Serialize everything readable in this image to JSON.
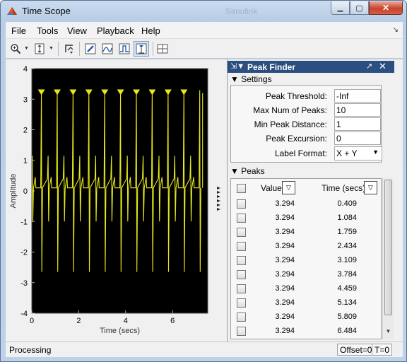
{
  "window": {
    "title": "Time Scope",
    "ghost_title": "Simulink",
    "minimize_glyph": "▁",
    "maximize_glyph": "▢",
    "close_glyph": "✕"
  },
  "menu": {
    "items": [
      "File",
      "Tools",
      "View",
      "Playback",
      "Help"
    ],
    "dock_arrow": "↘"
  },
  "toolbar": {
    "icons": [
      "zoom-in-icon",
      "zoom-y-icon",
      "autoscale-icon",
      "edit-style-icon",
      "bilevel-icon",
      "trigger-icon",
      "peak-finder-icon",
      "layout-icon"
    ],
    "dropdown_glyph": "▼"
  },
  "panel": {
    "title": "Peak Finder",
    "pin_glyph": "⇲▼",
    "undock_glyph": "↗",
    "close_glyph": "✕",
    "settings_heading": "▼ Settings",
    "settings": {
      "peak_threshold_label": "Peak Threshold:",
      "peak_threshold_value": "-Inf",
      "max_peaks_label": "Max Num of Peaks:",
      "max_peaks_value": "10",
      "min_distance_label": "Min Peak Distance:",
      "min_distance_value": "1",
      "peak_excursion_label": "Peak Excursion:",
      "peak_excursion_value": "0",
      "label_format_label": "Label Format:",
      "label_format_value": "X + Y",
      "select_arrow": "▼"
    },
    "peaks_heading": "▼ Peaks",
    "columns": {
      "value": "Value",
      "time": "Time (secs)",
      "sort_glyph": "▽"
    },
    "rows": [
      {
        "value": "3.294",
        "time": "0.409"
      },
      {
        "value": "3.294",
        "time": "1.084"
      },
      {
        "value": "3.294",
        "time": "1.759"
      },
      {
        "value": "3.294",
        "time": "2.434"
      },
      {
        "value": "3.294",
        "time": "3.109"
      },
      {
        "value": "3.294",
        "time": "3.784"
      },
      {
        "value": "3.294",
        "time": "4.459"
      },
      {
        "value": "3.294",
        "time": "5.134"
      },
      {
        "value": "3.294",
        "time": "5.809"
      },
      {
        "value": "3.294",
        "time": "6.484"
      }
    ],
    "scroll_down_glyph": "▼"
  },
  "status": {
    "text": "Processing",
    "offset": "Offset=0",
    "time": "T=0"
  },
  "colors": {
    "plot_background": "#000000",
    "signal": "#e6e61e",
    "panel_header": "#2b4f80",
    "axes_text": "#000000"
  },
  "chart_data": {
    "type": "line",
    "title": "",
    "xlabel": "Time (secs)",
    "ylabel": "Amplitude",
    "xlim": [
      0,
      7.5
    ],
    "ylim": [
      -4,
      4
    ],
    "xticks": [
      "0",
      "2",
      "4",
      "6"
    ],
    "xtick_values": [
      0,
      2,
      4,
      6
    ],
    "yticks": [
      "4",
      "3",
      "2",
      "1",
      "0",
      "-1",
      "-2",
      "-3",
      "-4"
    ],
    "ytick_values": [
      4,
      3,
      2,
      1,
      0,
      -1,
      -2,
      -3,
      -4
    ],
    "grid": false,
    "series": [
      {
        "period": 0.675,
        "first_peak_time": 0.409,
        "peak_value": 3.294,
        "trough_value": -2.65,
        "minor_peak_value": 1.15,
        "minor_trough_value": -1.0,
        "baseline": 0.1
      }
    ],
    "peak_markers": {
      "times": [
        0.409,
        1.084,
        1.759,
        2.434,
        3.109,
        3.784,
        4.459,
        5.134,
        5.809,
        6.484
      ],
      "value": 3.294
    },
    "right_edge_markers": 6
  }
}
